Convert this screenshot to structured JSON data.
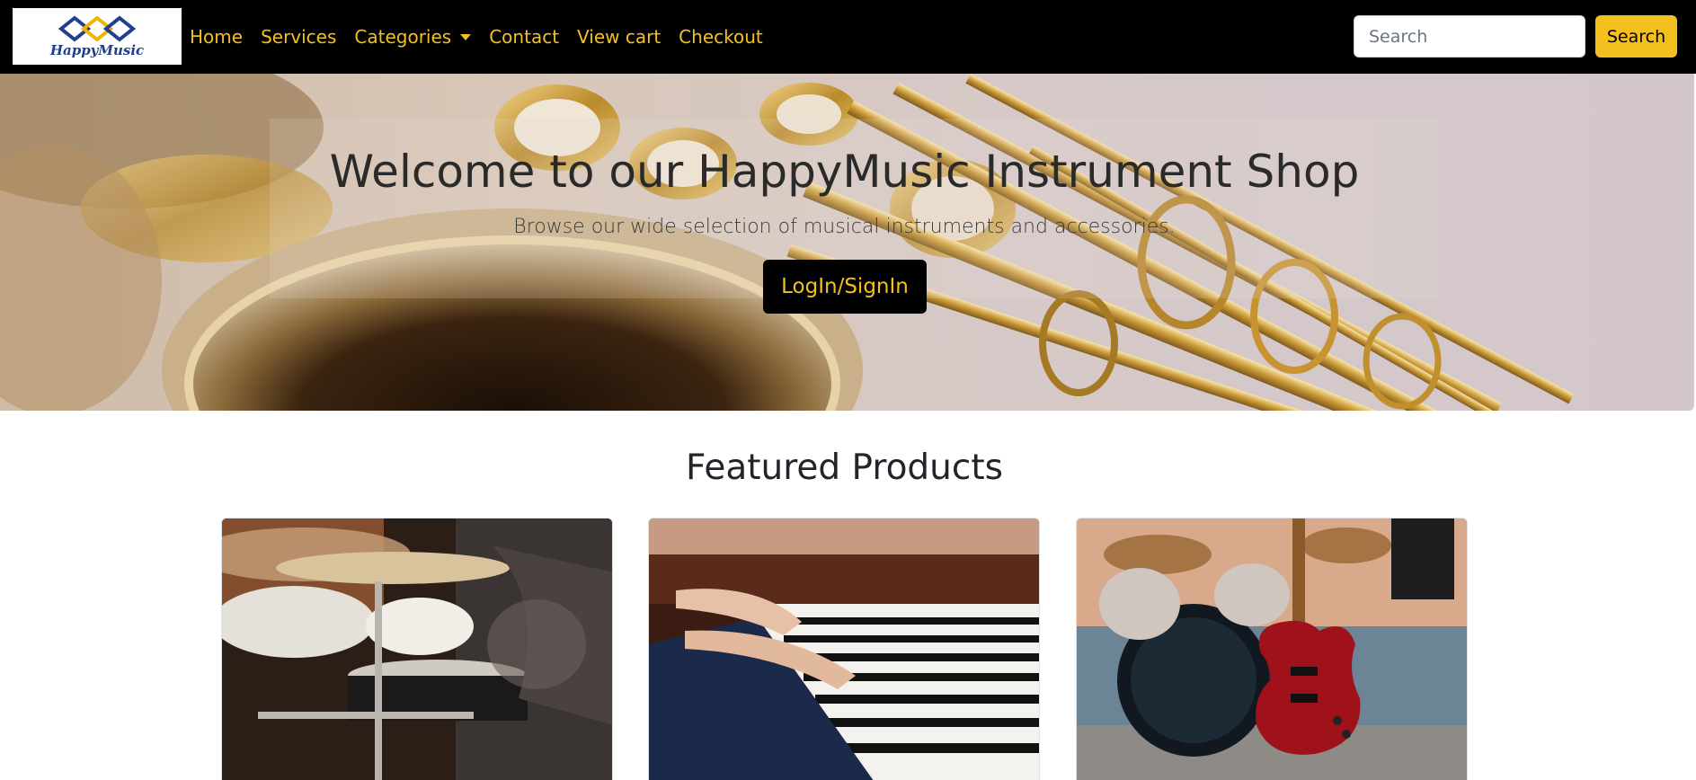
{
  "navbar": {
    "logo_text": "HappyMusic",
    "links": [
      {
        "label": "Home"
      },
      {
        "label": "Services"
      },
      {
        "label": "Categories",
        "dropdown": true
      },
      {
        "label": "Contact"
      },
      {
        "label": "View cart"
      },
      {
        "label": "Checkout"
      }
    ],
    "search": {
      "placeholder": "Search",
      "value": "",
      "button_label": "Search"
    }
  },
  "hero": {
    "title": "Welcome to our HappyMusic Instrument Shop",
    "subtitle": "Browse our wide selection of musical instruments and accessories.",
    "login_label": "LogIn/SignIn"
  },
  "featured": {
    "title": "Featured Products",
    "products": [
      {
        "image": "drum-kit-photo"
      },
      {
        "image": "piano-keys-photo"
      },
      {
        "image": "red-electric-guitar-photo"
      }
    ]
  },
  "colors": {
    "accent": "#f4c01e",
    "nav_background": "#000000",
    "text": "#212529"
  }
}
